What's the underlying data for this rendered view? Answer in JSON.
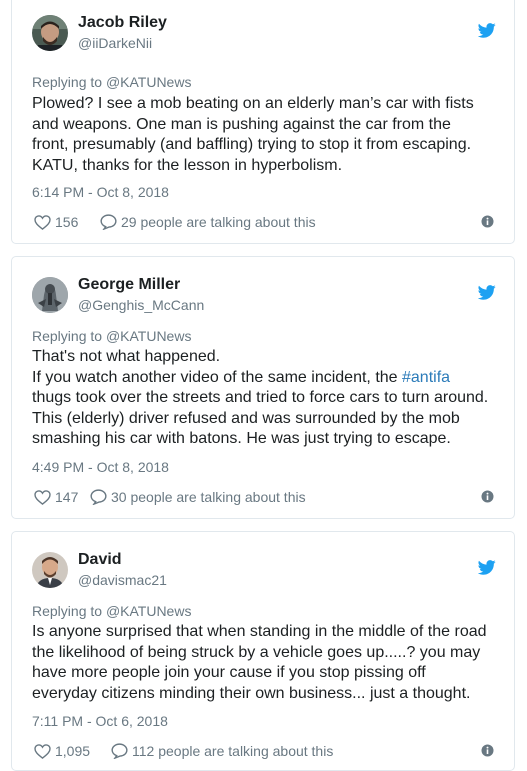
{
  "colors": {
    "link": "#2b7bb9",
    "muted": "#697882",
    "text": "#1c2022",
    "border": "#e1e8ed",
    "twitter_blue": "#1da1f2"
  },
  "tweets": [
    {
      "name": "Jacob Riley",
      "handle": "@iiDarkeNii",
      "replying_prefix": "Replying to ",
      "replying_to": "@KATUNews",
      "lines": [
        "Plowed?  I see a mob beating on an elderly man’s car with fists",
        "and weapons.  One man is pushing against the car from the",
        "front, presumably (and baffling) trying to stop it from escaping.",
        "KATU, thanks for the lesson in hyperbolism."
      ],
      "timestamp": "6:14 PM - Oct 8, 2018",
      "likes": "156",
      "talking": "29 people are talking about this",
      "icons": {
        "avatar": "avatar",
        "brand": "twitter-bird-icon",
        "like": "heart-icon",
        "talk": "speech-bubble-icon",
        "info": "info-icon"
      }
    },
    {
      "name": "George Miller",
      "handle": "@Genghis_McCann",
      "replying_prefix": "Replying to ",
      "replying_to": "@KATUNews",
      "line1": "That's not what happened.",
      "line2_pre": "If you watch another video of the same incident, the ",
      "line2_hashtag": "#antifa",
      "line3": "thugs took over the streets and tried to force cars to turn around.",
      "line4": "This (elderly) driver refused and was surrounded by the mob",
      "line5": "smashing his car with batons. He was just trying to escape.",
      "timestamp": "4:49 PM - Oct 8, 2018",
      "likes": "147",
      "talking": "30 people are talking about this"
    },
    {
      "name": "David",
      "handle": "@davismac21",
      "replying_prefix": "Replying to ",
      "replying_to": "@KATUNews",
      "lines": [
        "Is anyone surprised that when standing in the middle of the road",
        "the likelihood of being struck by a vehicle goes up.....? you may",
        "have more people join your cause if you stop pissing off",
        "everyday citizens minding their own business... just a thought."
      ],
      "timestamp": "7:11 PM - Oct 6, 2018",
      "likes": "1,095",
      "talking": "112 people are talking about this"
    }
  ]
}
